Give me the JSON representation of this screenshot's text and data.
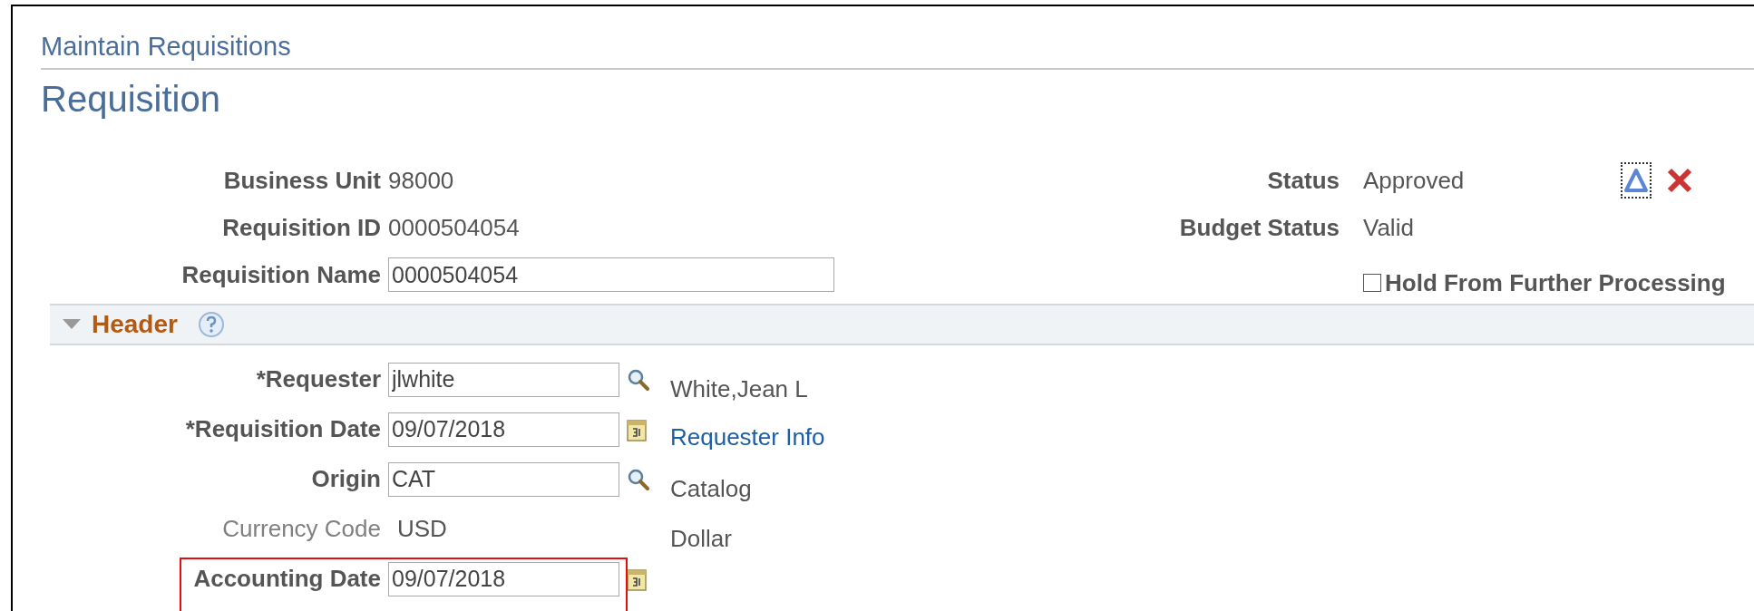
{
  "breadcrumb": "Maintain Requisitions",
  "title": "Requisition",
  "summary_fields": [
    {
      "kind": "text",
      "label": "Business Unit",
      "value": "98000"
    },
    {
      "kind": "text",
      "label": "Requisition ID",
      "value": "0000504054"
    },
    {
      "kind": "input",
      "label": "Requisition Name",
      "value": "0000504054"
    }
  ],
  "status_fields": [
    {
      "label": "Status",
      "value": "Approved"
    },
    {
      "label": "Budget Status",
      "value": "Valid"
    }
  ],
  "hold_checkbox": {
    "label": "Hold From Further Processing",
    "checked": false
  },
  "header_section": {
    "title": "Header",
    "expanded": true,
    "fields": [
      {
        "kind": "input",
        "label": "*Requester",
        "value": "jlwhite",
        "button": {
          "kind": "lookup"
        },
        "note": {
          "kind": "text",
          "text": "White,Jean L"
        },
        "highlighted": false
      },
      {
        "kind": "input",
        "label": "*Requisition Date",
        "value": "09/07/2018",
        "button": {
          "kind": "calendar"
        },
        "note": {
          "kind": "link",
          "text": "Requester Info"
        },
        "highlighted": false
      },
      {
        "kind": "input",
        "label": "Origin",
        "value": "CAT",
        "button": {
          "kind": "lookup"
        },
        "note": {
          "kind": "text",
          "text": "Catalog"
        },
        "highlighted": false
      },
      {
        "kind": "display",
        "label": "Currency Code",
        "value": "USD",
        "note": {
          "kind": "text",
          "text": "Dollar"
        },
        "highlighted": false
      },
      {
        "kind": "input",
        "label": "Accounting Date",
        "value": "09/07/2018",
        "button": {
          "kind": "calendar"
        },
        "highlighted": true
      }
    ]
  }
}
